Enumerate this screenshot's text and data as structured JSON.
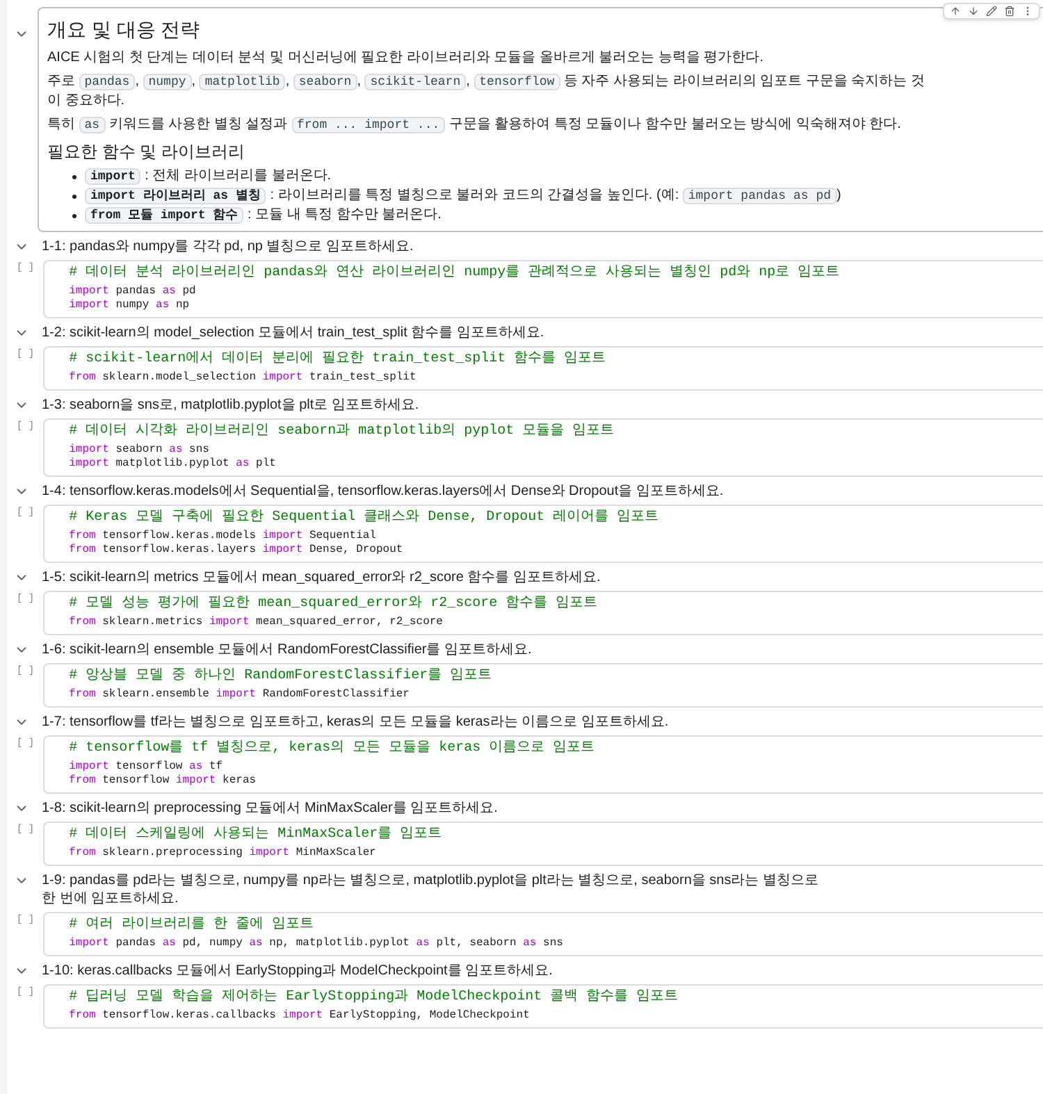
{
  "intro": {
    "expanded": true,
    "title": "개요 및 대응 전략",
    "paragraphs": [
      [
        {
          "kind": "text",
          "text": "AICE 시험의 첫 단계는 데이터 분석 및 머신러닝에 필요한 라이브러리와 모듈을 올바르게 불러오는 능력을 평가한다."
        }
      ],
      [
        {
          "kind": "text",
          "text": "주로 "
        },
        {
          "kind": "code",
          "text": "pandas"
        },
        {
          "kind": "text",
          "text": ", "
        },
        {
          "kind": "code",
          "text": "numpy"
        },
        {
          "kind": "text",
          "text": ", "
        },
        {
          "kind": "code",
          "text": "matplotlib"
        },
        {
          "kind": "text",
          "text": ", "
        },
        {
          "kind": "code",
          "text": "seaborn"
        },
        {
          "kind": "text",
          "text": ", "
        },
        {
          "kind": "code",
          "text": "scikit-learn"
        },
        {
          "kind": "text",
          "text": ", "
        },
        {
          "kind": "code",
          "text": "tensorflow"
        },
        {
          "kind": "text",
          "text": " 등 자주 사용되는 라이브러리의 임포트 구문을 숙지하는 것이 중요하다."
        }
      ],
      [
        {
          "kind": "text",
          "text": "특히 "
        },
        {
          "kind": "code",
          "text": "as"
        },
        {
          "kind": "text",
          "text": " 키워드를 사용한 별칭 설정과 "
        },
        {
          "kind": "code",
          "text": "from ... import ..."
        },
        {
          "kind": "text",
          "text": " 구문을 활용하여 특정 모듈이나 함수만 불러오는 방식에 익숙해져야 한다."
        }
      ]
    ],
    "subtitle": "필요한 함수 및 라이브러리",
    "bullets": [
      [
        {
          "kind": "strong_code",
          "text": "import"
        },
        {
          "kind": "text",
          "text": " : 전체 라이브러리를 불러온다."
        }
      ],
      [
        {
          "kind": "strong_code",
          "text": "import 라이브러리 as 별칭"
        },
        {
          "kind": "text",
          "text": " : 라이브러리를 특정 별칭으로 불러와 코드의 간결성을 높인다. (예: "
        },
        {
          "kind": "code",
          "text": "import pandas as pd"
        },
        {
          "kind": "text",
          "text": ")"
        }
      ],
      [
        {
          "kind": "strong_code",
          "text": "from 모듈 import 함수"
        },
        {
          "kind": "text",
          "text": " : 모듈 내 특정 함수만 불러온다."
        }
      ]
    ]
  },
  "sections": [
    {
      "title": "1-1: pandas와 numpy를 각각 pd, np 별칭으로 임포트하세요.",
      "expanded": true,
      "cell": {
        "run_label": "[ ]",
        "comment": "# 데이터 분석 라이브러리인 pandas와 연산 라이브러리인 numpy를 관례적으로 사용되는 별칭인 pd와 np로 임포트",
        "lines": [
          [
            {
              "kind": "keyword",
              "text": "import"
            },
            {
              "kind": "name",
              "text": " pandas "
            },
            {
              "kind": "keyword",
              "text": "as"
            },
            {
              "kind": "name",
              "text": " pd"
            }
          ],
          [
            {
              "kind": "keyword",
              "text": "import"
            },
            {
              "kind": "name",
              "text": " numpy "
            },
            {
              "kind": "keyword",
              "text": "as"
            },
            {
              "kind": "name",
              "text": " np"
            }
          ]
        ]
      }
    },
    {
      "title": "1-2: scikit-learn의 model_selection 모듈에서 train_test_split 함수를 임포트하세요.",
      "expanded": true,
      "cell": {
        "run_label": "[ ]",
        "comment": "# scikit-learn에서 데이터 분리에 필요한 train_test_split 함수를 임포트",
        "lines": [
          [
            {
              "kind": "keyword",
              "text": "from"
            },
            {
              "kind": "name",
              "text": " sklearn.model_selection "
            },
            {
              "kind": "keyword",
              "text": "import"
            },
            {
              "kind": "name",
              "text": " train_test_split"
            }
          ]
        ]
      }
    },
    {
      "title": "1-3: seaborn을 sns로, matplotlib.pyplot을 plt로 임포트하세요.",
      "expanded": true,
      "cell": {
        "run_label": "[ ]",
        "comment": "# 데이터 시각화 라이브러리인 seaborn과 matplotlib의 pyplot 모듈을 임포트",
        "lines": [
          [
            {
              "kind": "keyword",
              "text": "import"
            },
            {
              "kind": "name",
              "text": " seaborn "
            },
            {
              "kind": "keyword",
              "text": "as"
            },
            {
              "kind": "name",
              "text": " sns"
            }
          ],
          [
            {
              "kind": "keyword",
              "text": "import"
            },
            {
              "kind": "name",
              "text": " matplotlib.pyplot "
            },
            {
              "kind": "keyword",
              "text": "as"
            },
            {
              "kind": "name",
              "text": " plt"
            }
          ]
        ]
      }
    },
    {
      "title": "1-4: tensorflow.keras.models에서 Sequential을, tensorflow.keras.layers에서 Dense와 Dropout을 임포트하세요.",
      "expanded": true,
      "cell": {
        "run_label": "[ ]",
        "comment": "# Keras 모델 구축에 필요한 Sequential 클래스와 Dense, Dropout 레이어를 임포트",
        "lines": [
          [
            {
              "kind": "keyword",
              "text": "from"
            },
            {
              "kind": "name",
              "text": " tensorflow.keras.models "
            },
            {
              "kind": "keyword",
              "text": "import"
            },
            {
              "kind": "name",
              "text": " Sequential"
            }
          ],
          [
            {
              "kind": "keyword",
              "text": "from"
            },
            {
              "kind": "name",
              "text": " tensorflow.keras.layers "
            },
            {
              "kind": "keyword",
              "text": "import"
            },
            {
              "kind": "name",
              "text": " Dense, Dropout"
            }
          ]
        ]
      }
    },
    {
      "title": "1-5: scikit-learn의 metrics 모듈에서 mean_squared_error와 r2_score 함수를 임포트하세요.",
      "expanded": true,
      "cell": {
        "run_label": "[ ]",
        "comment": "# 모델 성능 평가에 필요한 mean_squared_error와 r2_score 함수를 임포트",
        "lines": [
          [
            {
              "kind": "keyword",
              "text": "from"
            },
            {
              "kind": "name",
              "text": " sklearn.metrics "
            },
            {
              "kind": "keyword",
              "text": "import"
            },
            {
              "kind": "name",
              "text": " mean_squared_error, r2_score"
            }
          ]
        ]
      }
    },
    {
      "title": "1-6: scikit-learn의 ensemble 모듈에서 RandomForestClassifier를 임포트하세요.",
      "expanded": true,
      "cell": {
        "run_label": "[ ]",
        "comment": "# 앙상블 모델 중 하나인 RandomForestClassifier를 임포트",
        "lines": [
          [
            {
              "kind": "keyword",
              "text": "from"
            },
            {
              "kind": "name",
              "text": " sklearn.ensemble "
            },
            {
              "kind": "keyword",
              "text": "import"
            },
            {
              "kind": "name",
              "text": " RandomForestClassifier"
            }
          ]
        ]
      }
    },
    {
      "title": "1-7: tensorflow를 tf라는 별칭으로 임포트하고, keras의 모든 모듈을 keras라는 이름으로 임포트하세요.",
      "expanded": true,
      "cell": {
        "run_label": "[ ]",
        "comment": "# tensorflow를 tf 별칭으로, keras의 모든 모듈을 keras 이름으로 임포트",
        "lines": [
          [
            {
              "kind": "keyword",
              "text": "import"
            },
            {
              "kind": "name",
              "text": " tensorflow "
            },
            {
              "kind": "keyword",
              "text": "as"
            },
            {
              "kind": "name",
              "text": " tf"
            }
          ],
          [
            {
              "kind": "keyword",
              "text": "from"
            },
            {
              "kind": "name",
              "text": " tensorflow "
            },
            {
              "kind": "keyword",
              "text": "import"
            },
            {
              "kind": "name",
              "text": " keras"
            }
          ]
        ]
      }
    },
    {
      "title": "1-8: scikit-learn의 preprocessing 모듈에서 MinMaxScaler를 임포트하세요.",
      "expanded": true,
      "cell": {
        "run_label": "[ ]",
        "comment": "# 데이터 스케일링에 사용되는 MinMaxScaler를 임포트",
        "lines": [
          [
            {
              "kind": "keyword",
              "text": "from"
            },
            {
              "kind": "name",
              "text": " sklearn.preprocessing "
            },
            {
              "kind": "keyword",
              "text": "import"
            },
            {
              "kind": "name",
              "text": " MinMaxScaler"
            }
          ]
        ]
      }
    },
    {
      "title": "1-9: pandas를 pd라는 별칭으로, numpy를 np라는 별칭으로, matplotlib.pyplot을 plt라는 별칭으로, seaborn을 sns라는 별칭으로 한 번에 임포트하세요.",
      "expanded": true,
      "cell": {
        "run_label": "[ ]",
        "comment": "# 여러 라이브러리를 한 줄에 임포트",
        "lines": [
          [
            {
              "kind": "keyword",
              "text": "import"
            },
            {
              "kind": "name",
              "text": " pandas "
            },
            {
              "kind": "keyword",
              "text": "as"
            },
            {
              "kind": "name",
              "text": " pd, numpy "
            },
            {
              "kind": "keyword",
              "text": "as"
            },
            {
              "kind": "name",
              "text": " np, matplotlib.pyplot "
            },
            {
              "kind": "keyword",
              "text": "as"
            },
            {
              "kind": "name",
              "text": " plt, seaborn "
            },
            {
              "kind": "keyword",
              "text": "as"
            },
            {
              "kind": "name",
              "text": " sns"
            }
          ]
        ]
      }
    },
    {
      "title": "1-10: keras.callbacks 모듈에서 EarlyStopping과 ModelCheckpoint를 임포트하세요.",
      "expanded": true,
      "cell": {
        "run_label": "[ ]",
        "comment": "# 딥러닝 모델 학습을 제어하는 EarlyStopping과 ModelCheckpoint 콜백 함수를 임포트",
        "lines": [
          [
            {
              "kind": "keyword",
              "text": "from"
            },
            {
              "kind": "name",
              "text": " tensorflow.keras.callbacks "
            },
            {
              "kind": "keyword",
              "text": "import"
            },
            {
              "kind": "name",
              "text": " EarlyStopping, ModelCheckpoint"
            }
          ]
        ]
      }
    }
  ]
}
